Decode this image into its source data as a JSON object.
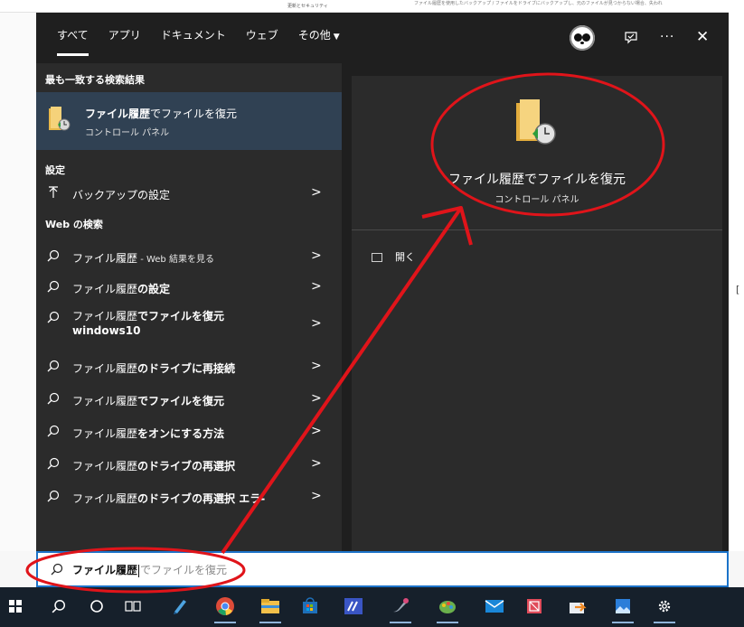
{
  "background": {
    "doc_left_text": "更新とセキュリティ",
    "doc_right_text": "ファイル履歴を使用したバックアップ / ファイルをドライブにバックアップし、元のファイルが見つからない場合、失われ",
    "right_edge_glyph": "["
  },
  "tabs": [
    {
      "label": "すべて",
      "active": true
    },
    {
      "label": "アプリ",
      "active": false
    },
    {
      "label": "ドキュメント",
      "active": false
    },
    {
      "label": "ウェブ",
      "active": false
    },
    {
      "label": "その他",
      "active": false,
      "has_dropdown": true
    }
  ],
  "top_icons": {
    "avatar": "panda-avatar",
    "feedback": "feedback-icon",
    "more": "···",
    "close": "✕"
  },
  "left": {
    "best_match_header": "最も一致する検索結果",
    "best_match": {
      "title_bold": "ファイル履歴",
      "title_rest": "でファイルを復元",
      "subtitle": "コントロール パネル"
    },
    "settings_header": "設定",
    "settings_items": [
      {
        "label": "バックアップの設定",
        "icon": "backup-arrow-icon"
      }
    ],
    "web_header": "Web の検索",
    "web_items": [
      {
        "prefix": "ファイル履歴",
        "bold": "",
        "suffix_small": " - Web 結果を見る",
        "line2": ""
      },
      {
        "prefix": "ファイル履歴",
        "bold": "の設定",
        "suffix_small": "",
        "line2": ""
      },
      {
        "prefix": "ファイル履歴",
        "bold": "でファイルを復元",
        "suffix_small": "",
        "line2": "windows10"
      },
      {
        "prefix": "ファイル履歴",
        "bold": "のドライブに再接続",
        "suffix_small": "",
        "line2": ""
      },
      {
        "prefix": "ファイル履歴",
        "bold": "でファイルを復元",
        "suffix_small": "",
        "line2": ""
      },
      {
        "prefix": "ファイル履歴",
        "bold": "をオンにする方法",
        "suffix_small": "",
        "line2": ""
      },
      {
        "prefix": "ファイル履歴",
        "bold": "のドライブの再選択",
        "suffix_small": "",
        "line2": ""
      },
      {
        "prefix": "ファイル履歴",
        "bold": "のドライブの再選択 エラ-",
        "suffix_small": "",
        "line2": ""
      }
    ],
    "arrow": ">"
  },
  "preview": {
    "title": "ファイル履歴でファイルを復元",
    "subtitle": "コントロール パネル",
    "action": "開く"
  },
  "search": {
    "typed": "ファイル履歴",
    "ghost": "でファイルを復元"
  },
  "taskbar": [
    "windows-start-icon",
    "search-icon",
    "cortana-circle-icon",
    "task-view-icon",
    "notepad-icon",
    "chrome-icon",
    "file-explorer-icon",
    "store-icon",
    "app-blue-icon",
    "paint-tool-icon",
    "paint-palette-icon",
    "mail-icon",
    "image-editor-icon",
    "share-icon",
    "photos-icon",
    "settings-icon"
  ],
  "colors": {
    "annotation": "#e0141a",
    "accent": "#1c73c9",
    "menu_bg": "#1f1f1f",
    "panel_bg": "#2b2b2b",
    "selected": "#304153",
    "taskbar": "#16202b"
  }
}
